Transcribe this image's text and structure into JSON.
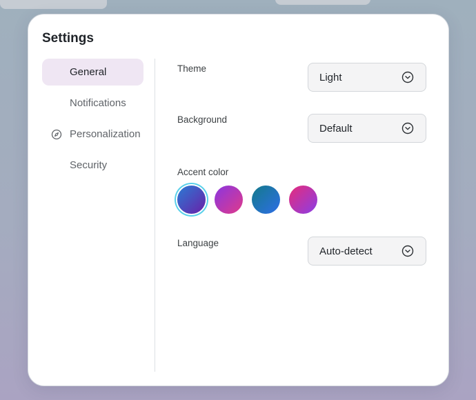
{
  "settings": {
    "title": "Settings",
    "sidebar": {
      "items": [
        {
          "label": "General",
          "active": true,
          "icon": ""
        },
        {
          "label": "Notifications",
          "active": false,
          "icon": ""
        },
        {
          "label": "Personalization",
          "active": false,
          "icon": "compass-icon"
        },
        {
          "label": "Security",
          "active": false,
          "icon": ""
        }
      ]
    },
    "theme": {
      "label": "Theme",
      "value": "Light"
    },
    "background": {
      "label": "Background",
      "value": "Default"
    },
    "accent": {
      "label": "Accent color",
      "selected_index": 0,
      "swatches": [
        {
          "name": "blue-violet",
          "from": "#2a7bd4",
          "to": "#6a1fa8"
        },
        {
          "name": "violet-pink",
          "from": "#8a36e0",
          "to": "#e03a8a"
        },
        {
          "name": "teal-blue",
          "from": "#137a8a",
          "to": "#2e6ee6"
        },
        {
          "name": "pink-purple",
          "from": "#e62c7a",
          "to": "#8a3ee6"
        }
      ]
    },
    "language": {
      "label": "Language",
      "value": "Auto-detect"
    }
  }
}
